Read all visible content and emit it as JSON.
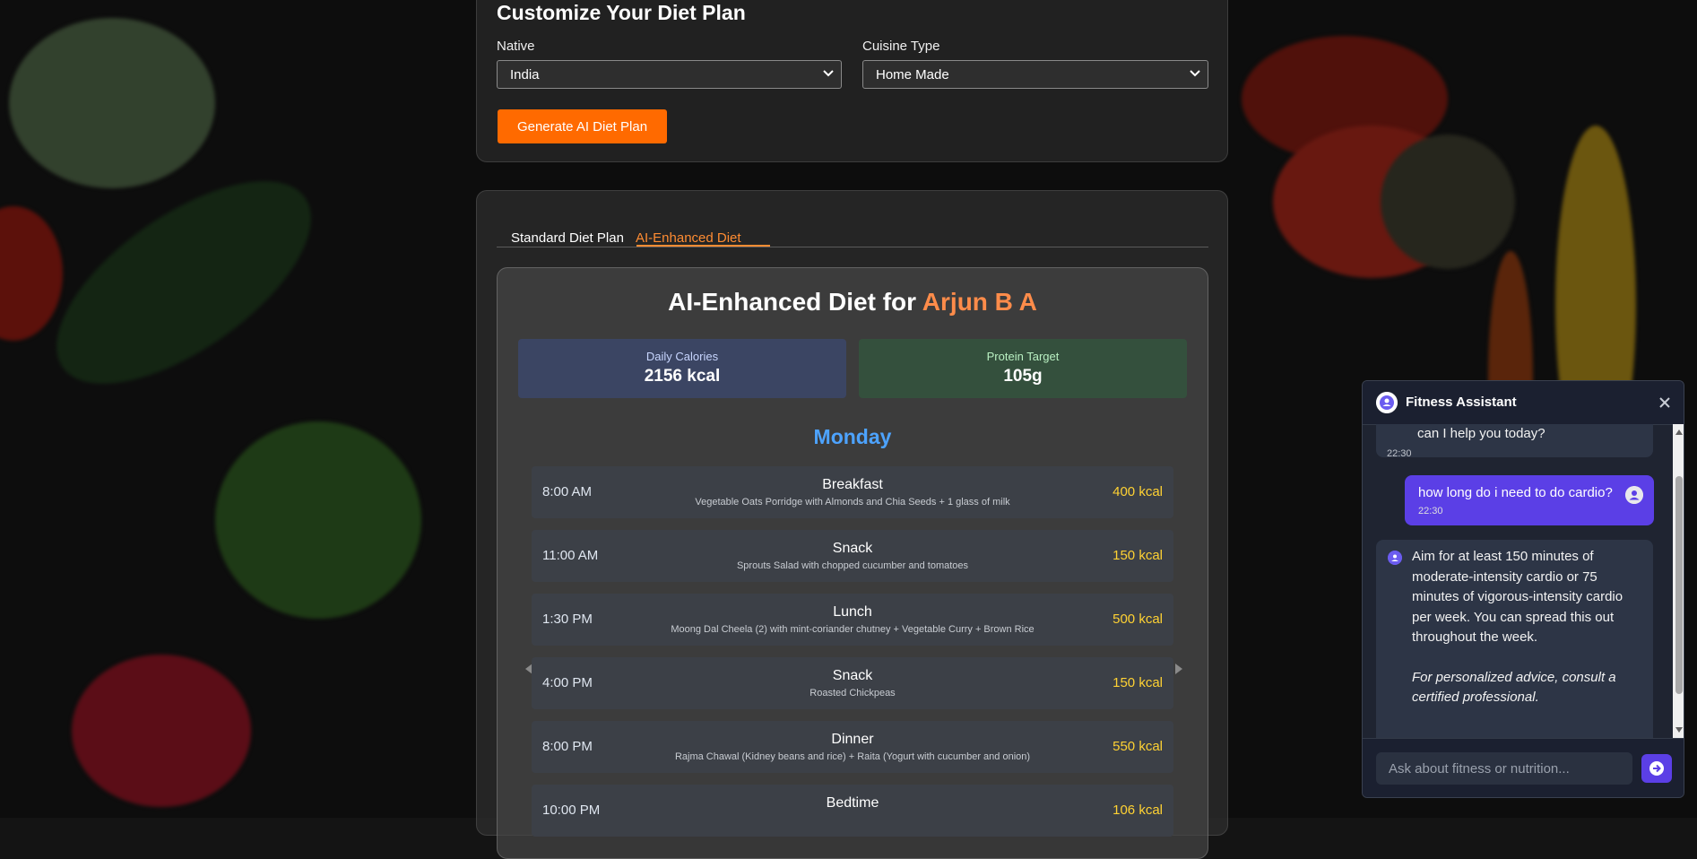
{
  "customize": {
    "title": "Customize Your Diet Plan",
    "native_label": "Native",
    "native_value": "India",
    "cuisine_label": "Cuisine Type",
    "cuisine_value": "Home Made",
    "generate_label": "Generate AI Diet Plan"
  },
  "tabs": [
    {
      "label": "Standard Diet Plan",
      "active": false
    },
    {
      "label": "AI-Enhanced Diet",
      "active": true
    }
  ],
  "diet": {
    "title_prefix": "AI-Enhanced Diet for",
    "name": "Arjun B A",
    "calories_label": "Daily Calories",
    "calories_value": "2156 kcal",
    "protein_label": "Protein Target",
    "protein_value": "105g",
    "day": "Monday",
    "meals": [
      {
        "time": "8:00 AM",
        "name": "Breakfast",
        "desc": "Vegetable Oats Porridge with Almonds and Chia Seeds + 1 glass of milk",
        "kcal": "400 kcal"
      },
      {
        "time": "11:00 AM",
        "name": "Snack",
        "desc": "Sprouts Salad with chopped cucumber and tomatoes",
        "kcal": "150 kcal"
      },
      {
        "time": "1:30 PM",
        "name": "Lunch",
        "desc": "Moong Dal Cheela (2) with mint-coriander chutney + Vegetable Curry + Brown Rice",
        "kcal": "500 kcal"
      },
      {
        "time": "4:00 PM",
        "name": "Snack",
        "desc": "Roasted Chickpeas",
        "kcal": "150 kcal"
      },
      {
        "time": "8:00 PM",
        "name": "Dinner",
        "desc": "Rajma Chawal (Kidney beans and rice) + Raita (Yogurt with cucumber and onion)",
        "kcal": "550 kcal"
      },
      {
        "time": "10:00 PM",
        "name": "Bedtime",
        "desc": "",
        "kcal": "106 kcal"
      }
    ]
  },
  "chat": {
    "title": "Fitness Assistant",
    "messages": [
      {
        "role": "bot",
        "text": "can I help you today?",
        "time": "22:30"
      },
      {
        "role": "user",
        "text": "how long do i need to do  cardio?",
        "time": "22:30"
      },
      {
        "role": "bot",
        "text": "Aim for at least 150 minutes of moderate-intensity cardio or 75 minutes of vigorous-intensity cardio per week.  You can spread this out throughout the week.",
        "note": "For personalized advice, consult a certified professional."
      }
    ],
    "input_placeholder": "Ask about fitness or nutrition..."
  },
  "colors": {
    "accent": "#ff6a00",
    "tab_active": "#ff8c32",
    "day": "#4da3ff",
    "kcal": "#ffd233",
    "chat_accent": "#5b3fe6"
  }
}
